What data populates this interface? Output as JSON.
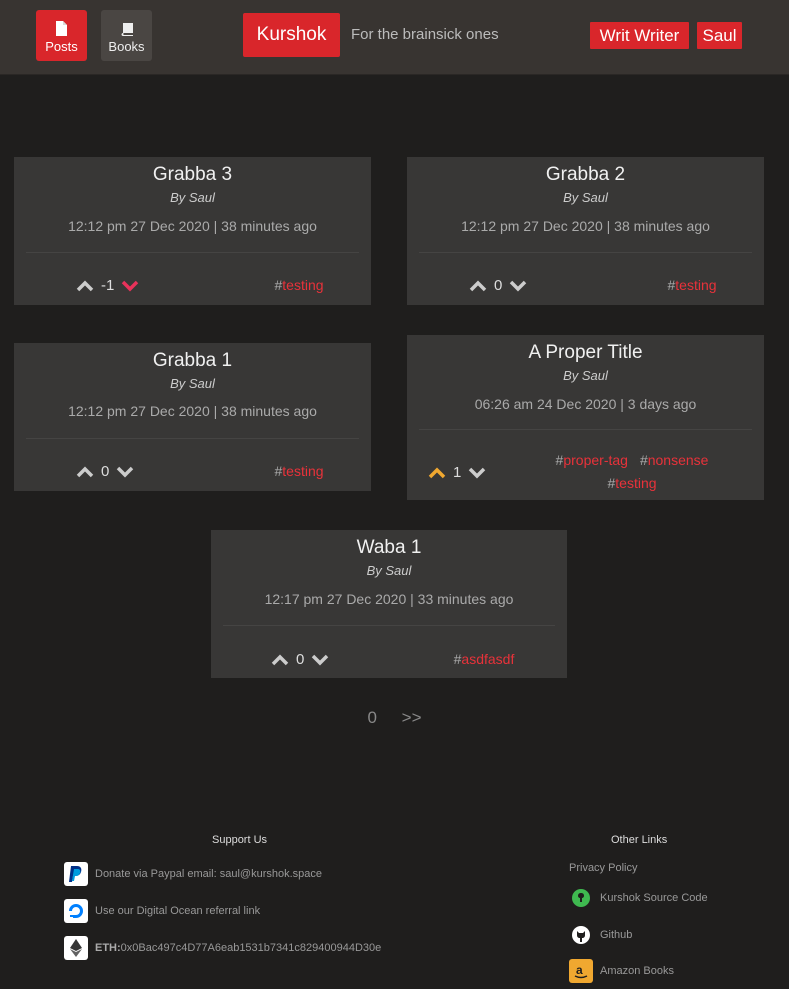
{
  "nav": {
    "posts_label": "Posts",
    "books_label": "Books",
    "brand": "Kurshok",
    "tagline": "For the brainsick ones",
    "writ_label": "Writ Writer",
    "user_label": "Saul"
  },
  "posts": [
    {
      "title": "Grabba 3",
      "author": "By Saul",
      "date": "12:12 pm 27 Dec 2020 | 38 minutes ago",
      "votes": "-1",
      "vote_state": "down",
      "tags": [
        "testing"
      ]
    },
    {
      "title": "Grabba 2",
      "author": "By Saul",
      "date": "12:12 pm 27 Dec 2020 | 38 minutes ago",
      "votes": "0",
      "vote_state": "none",
      "tags": [
        "testing"
      ]
    },
    {
      "title": "Grabba 1",
      "author": "By Saul",
      "date": "12:12 pm 27 Dec 2020 | 38 minutes ago",
      "votes": "0",
      "vote_state": "none",
      "tags": [
        "testing"
      ]
    },
    {
      "title": "A Proper Title",
      "author": "By Saul",
      "date": "06:26 am 24 Dec 2020 | 3 days ago",
      "votes": "1",
      "vote_state": "up",
      "tags": [
        "proper-tag",
        "nonsense",
        "testing"
      ]
    },
    {
      "title": "Waba 1",
      "author": "By Saul",
      "date": "12:17 pm 27 Dec 2020 | 33 minutes ago",
      "votes": "0",
      "vote_state": "none",
      "tags": [
        "asdfasdf"
      ]
    }
  ],
  "pager": {
    "current": "0",
    "next": ">>"
  },
  "footer": {
    "support_heading": "Support Us",
    "paypal": "Donate via Paypal email: saul@kurshok.space",
    "digitalocean": "Use our Digital Ocean referral link",
    "eth_label": "ETH:",
    "eth_address": "0x0Bac497c4D77A6eab1531b7341c829400944D30e",
    "other_heading": "Other Links",
    "privacy": "Privacy Policy",
    "source": "Kurshok Source Code",
    "github": "Github",
    "amazon": "Amazon Books"
  },
  "colors": {
    "accent": "#d9262b",
    "tag": "#e8323a",
    "upvote": "#f0a830",
    "downvote": "#e8325a",
    "neutral": "#cccccc"
  }
}
